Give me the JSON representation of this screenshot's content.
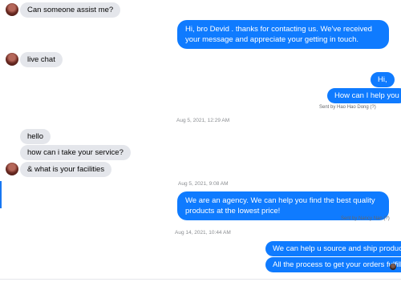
{
  "messages": {
    "m1": "Can someone assist me?",
    "m2": "Hi, bro Devid . thanks for contacting us. We've received your message and appreciate your getting in touch.",
    "m3": "live chat",
    "m4": "Hi,",
    "m5": "How can I help you",
    "m6": "hello",
    "m7": "how can i take your service?",
    "m8": "& what is your facilities",
    "m9": "We are an agency. We can help you find the best quality products at the lowest price!",
    "m10": "We can help u source and ship products",
    "m11": "All the process to get your orders fulfilled"
  },
  "sent_by": {
    "s1": "Sent by Hao Hao Dong (?)",
    "s2": "Sent by Nancy Nan (?)"
  },
  "timestamps": {
    "t1": "Aug 5, 2021, 12:29 AM",
    "t2": "Aug 5, 2021, 9:08 AM",
    "t3": "Aug 14, 2021, 10:44 AM"
  },
  "colors": {
    "outgoing": "#0f7bff",
    "incoming": "#e4e6eb"
  }
}
